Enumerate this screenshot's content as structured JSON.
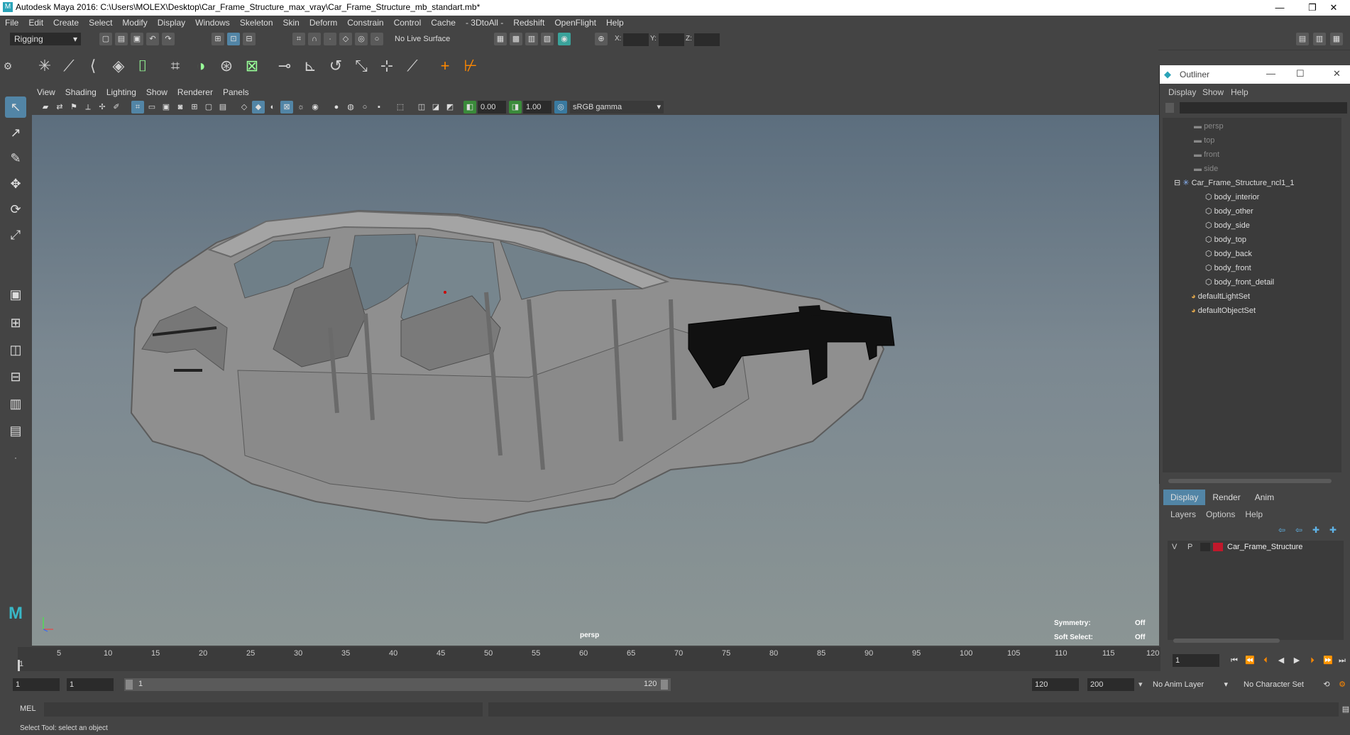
{
  "window": {
    "title": "Autodesk Maya 2016: C:\\Users\\MOLEX\\Desktop\\Car_Frame_Structure_max_vray\\Car_Frame_Structure_mb_standart.mb*",
    "app_icon": "M",
    "minimize": "—",
    "restore": "❐",
    "close": "✕"
  },
  "menubar": [
    "File",
    "Edit",
    "Create",
    "Select",
    "Modify",
    "Display",
    "Windows",
    "Skeleton",
    "Skin",
    "Deform",
    "Constrain",
    "Control",
    "Cache",
    "- 3DtoAll -",
    "Redshift",
    "OpenFlight",
    "Help"
  ],
  "statusline": {
    "mode": "Rigging",
    "live_surface": "No Live Surface",
    "x_label": "X:",
    "y_label": "Y:",
    "z_label": "Z:"
  },
  "panel_menu": [
    "View",
    "Shading",
    "Lighting",
    "Show",
    "Renderer",
    "Panels"
  ],
  "viewport_toolbar": {
    "exposure": "0.00",
    "gamma": "1.00",
    "color_space": "sRGB gamma"
  },
  "viewport": {
    "camera_label": "persp",
    "symmetry_label": "Symmetry:",
    "symmetry_value": "Off",
    "soft_select_label": "Soft Select:",
    "soft_select_value": "Off"
  },
  "outliner": {
    "title": "Outliner",
    "menu": [
      "Display",
      "Show",
      "Help"
    ],
    "cameras": [
      "persp",
      "top",
      "front",
      "side"
    ],
    "group": "Car_Frame_Structure_ncl1_1",
    "children": [
      "body_interior",
      "body_other",
      "body_side",
      "body_top",
      "body_back",
      "body_front",
      "body_front_detail"
    ],
    "sets": [
      "defaultLightSet",
      "defaultObjectSet"
    ]
  },
  "layers": {
    "tabs": [
      "Display",
      "Render",
      "Anim"
    ],
    "menu": [
      "Layers",
      "Options",
      "Help"
    ],
    "layer_v": "V",
    "layer_p": "P",
    "layer_name": "Car_Frame_Structure",
    "layer_color": "#c0182b"
  },
  "timeline": {
    "ticks": [
      "5",
      "10",
      "15",
      "20",
      "25",
      "30",
      "35",
      "40",
      "45",
      "50",
      "55",
      "60",
      "65",
      "70",
      "75",
      "80",
      "85",
      "90",
      "95",
      "100",
      "105",
      "110",
      "115",
      "120"
    ],
    "first_tick": "1",
    "current_frame": "1"
  },
  "range": {
    "start": "1",
    "playback_start": "1",
    "slider_start": "1",
    "slider_end": "120",
    "playback_end": "120",
    "end": "200",
    "anim_layer": "No Anim Layer",
    "character_set": "No Character Set"
  },
  "command_line": {
    "language": "MEL"
  },
  "help_line": "Select Tool: select an object"
}
